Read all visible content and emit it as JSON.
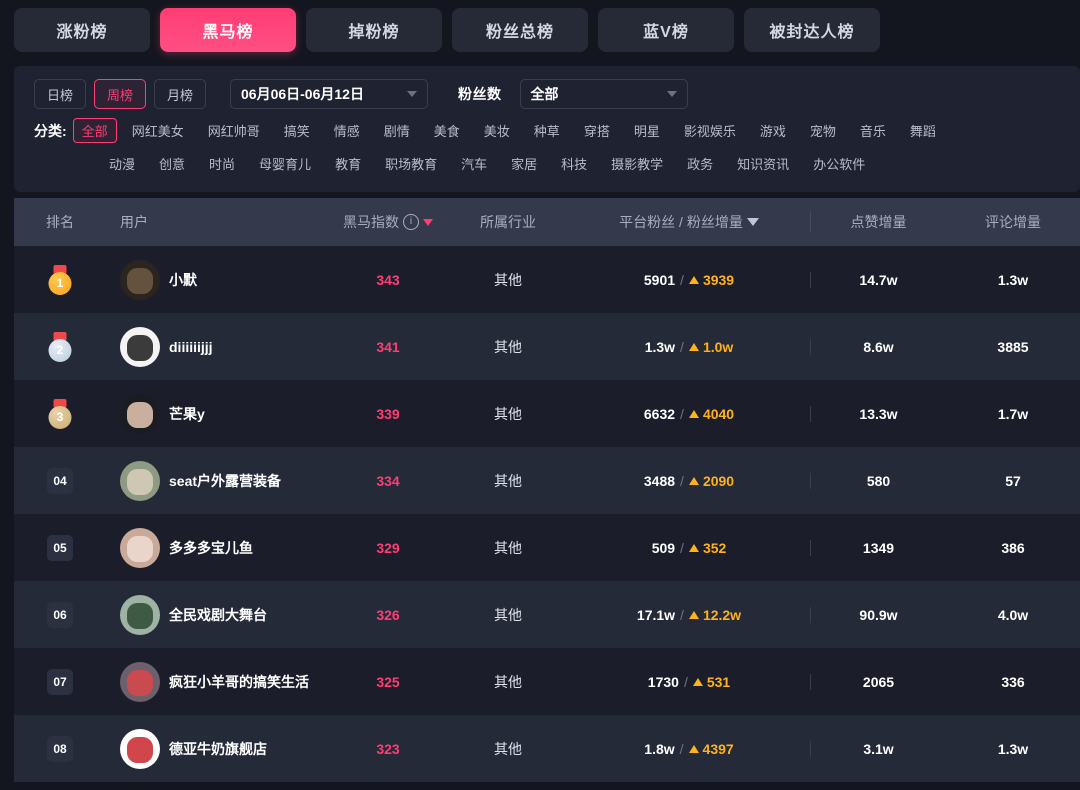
{
  "tabs": [
    {
      "label": "涨粉榜",
      "active": false
    },
    {
      "label": "黑马榜",
      "active": true
    },
    {
      "label": "掉粉榜",
      "active": false
    },
    {
      "label": "粉丝总榜",
      "active": false
    },
    {
      "label": "蓝V榜",
      "active": false
    },
    {
      "label": "被封达人榜",
      "active": false
    }
  ],
  "filters": {
    "period": [
      {
        "label": "日榜",
        "active": false
      },
      {
        "label": "周榜",
        "active": true
      },
      {
        "label": "月榜",
        "active": false
      }
    ],
    "date_range": "06月06日-06月12日",
    "fans_label": "粉丝数",
    "fans_value": "全部",
    "category_label": "分类:",
    "categories_row1": [
      "全部",
      "网红美女",
      "网红帅哥",
      "搞笑",
      "情感",
      "剧情",
      "美食",
      "美妆",
      "种草",
      "穿搭",
      "明星",
      "影视娱乐",
      "游戏",
      "宠物",
      "音乐",
      "舞蹈"
    ],
    "categories_row2": [
      "动漫",
      "创意",
      "时尚",
      "母婴育儿",
      "教育",
      "职场教育",
      "汽车",
      "家居",
      "科技",
      "摄影教学",
      "政务",
      "知识资讯",
      "办公软件"
    ],
    "active_category": "全部"
  },
  "table": {
    "headers": {
      "rank": "排名",
      "user": "用户",
      "index": "黑马指数",
      "index_info": "i",
      "industry": "所属行业",
      "fans": "平台粉丝 / 粉丝增量",
      "likes": "点赞增量",
      "comments": "评论增量"
    },
    "rows": [
      {
        "rank": "1",
        "medal": "g",
        "name": "小默",
        "score": "343",
        "industry": "其他",
        "fans": "5901",
        "delta": "3939",
        "likes": "14.7w",
        "comments": "1.3w",
        "avatar_bg": "#2b2520",
        "avatar_fg": "#6e5b45"
      },
      {
        "rank": "2",
        "medal": "s",
        "name": "diiiiiijjj",
        "score": "341",
        "industry": "其他",
        "fans": "1.3w",
        "delta": "1.0w",
        "likes": "8.6w",
        "comments": "3885",
        "avatar_bg": "#f4f4f4",
        "avatar_fg": "#1a1a1a"
      },
      {
        "rank": "3",
        "medal": "b",
        "name": "芒果y",
        "score": "339",
        "industry": "其他",
        "fans": "6632",
        "delta": "4040",
        "likes": "13.3w",
        "comments": "1.7w",
        "avatar_bg": "#1b1b22",
        "avatar_fg": "#e8c9b4"
      },
      {
        "rank": "04",
        "medal": "",
        "name": "seat户外露营装备",
        "score": "334",
        "industry": "其他",
        "fans": "3488",
        "delta": "2090",
        "likes": "580",
        "comments": "57",
        "avatar_bg": "#8d9b82",
        "avatar_fg": "#d8cfbc"
      },
      {
        "rank": "05",
        "medal": "",
        "name": "多多多宝儿鱼",
        "score": "329",
        "industry": "其他",
        "fans": "509",
        "delta": "352",
        "likes": "1349",
        "comments": "386",
        "avatar_bg": "#c9aa9a",
        "avatar_fg": "#f0ddd2"
      },
      {
        "rank": "06",
        "medal": "",
        "name": "全民戏剧大舞台",
        "score": "326",
        "industry": "其他",
        "fans": "17.1w",
        "delta": "12.2w",
        "likes": "90.9w",
        "comments": "4.0w",
        "avatar_bg": "#9fb3a4",
        "avatar_fg": "#2e4a34"
      },
      {
        "rank": "07",
        "medal": "",
        "name": "疯狂小羊哥的搞笑生活",
        "score": "325",
        "industry": "其他",
        "fans": "1730",
        "delta": "531",
        "likes": "2065",
        "comments": "336",
        "avatar_bg": "#6d5f6b",
        "avatar_fg": "#d9484a"
      },
      {
        "rank": "08",
        "medal": "",
        "name": "德亚牛奶旗舰店",
        "score": "323",
        "industry": "其他",
        "fans": "1.8w",
        "delta": "4397",
        "likes": "3.1w",
        "comments": "1.3w",
        "avatar_bg": "#ffffff",
        "avatar_fg": "#c8262c"
      }
    ]
  },
  "colors": {
    "accent": "#ff3d74",
    "delta": "#ffb21c",
    "page_bg": "#14161f",
    "panel_bg": "#1f2230",
    "header_bg": "#343a4c"
  }
}
